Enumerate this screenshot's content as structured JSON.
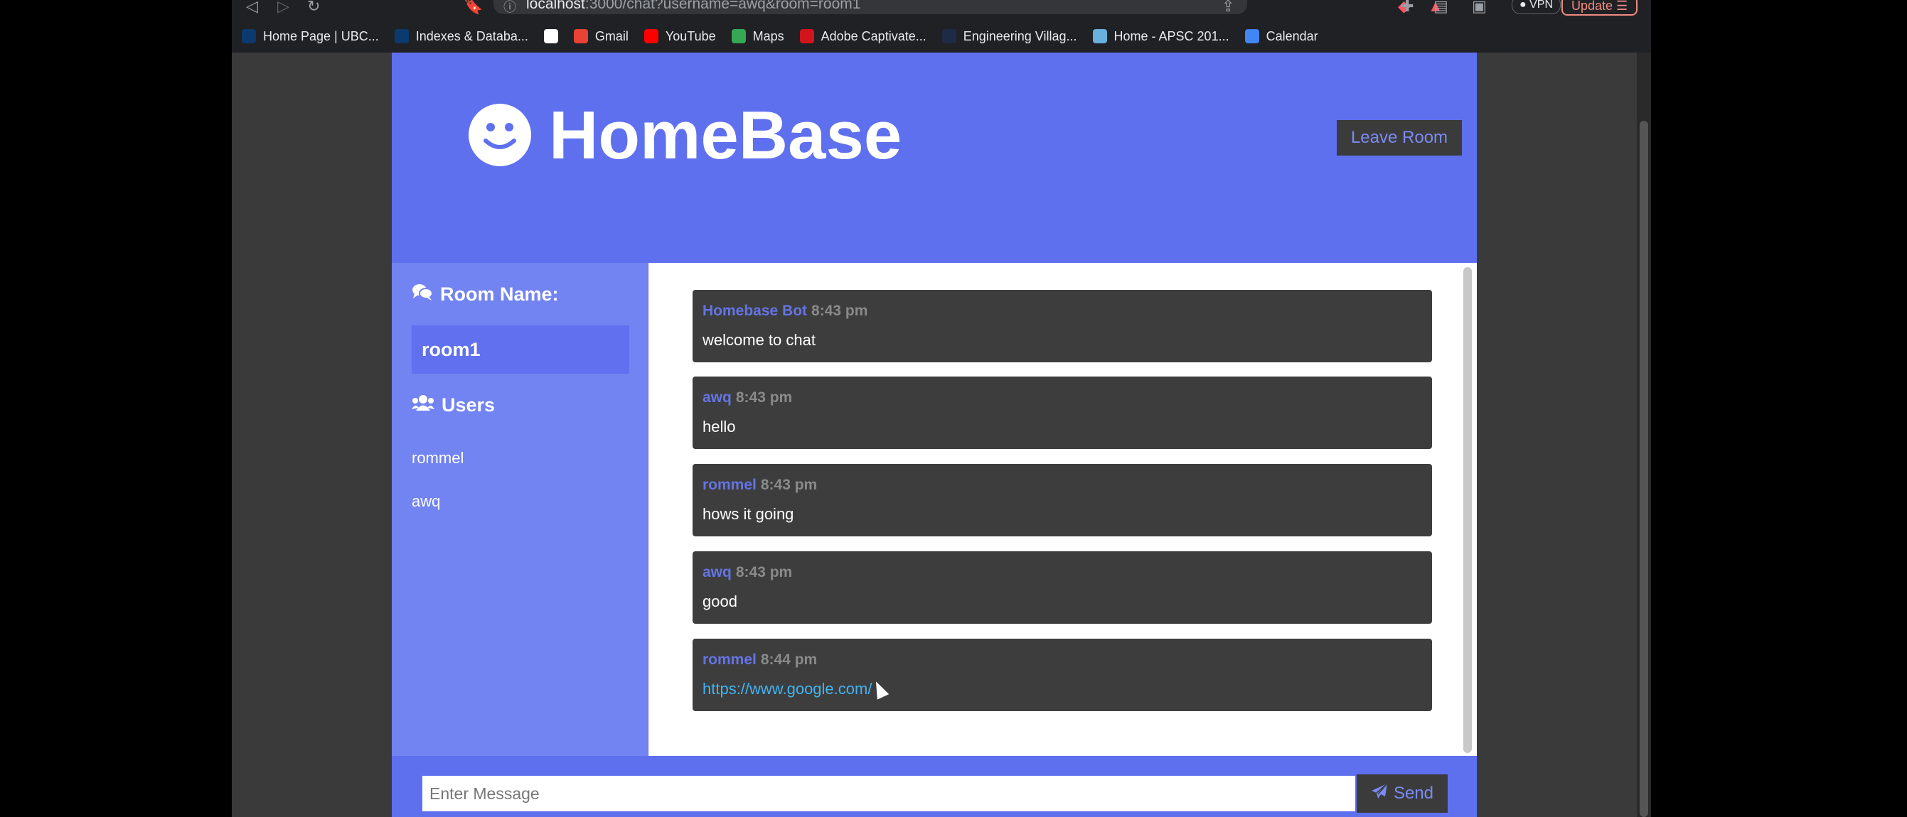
{
  "browser": {
    "url_host": "localhost",
    "url_rest": ":3000/chat?username=awq&room=room1",
    "vpn_label": "VPN",
    "update_label": "Update",
    "bookmarks": [
      {
        "label": "Home Page | UBC...",
        "icon": "ubc-icon",
        "color": "#0b3b6e"
      },
      {
        "label": "Indexes & Databa...",
        "icon": "ubc-icon",
        "color": "#0b3b6e"
      },
      {
        "label": "",
        "icon": "google-icon",
        "color": "#ffffff"
      },
      {
        "label": "Gmail",
        "icon": "gmail-icon",
        "color": "#ea4335"
      },
      {
        "label": "YouTube",
        "icon": "youtube-icon",
        "color": "#ff0000"
      },
      {
        "label": "Maps",
        "icon": "maps-icon",
        "color": "#34a853"
      },
      {
        "label": "Adobe Captivate...",
        "icon": "adobe-icon",
        "color": "#d4141c"
      },
      {
        "label": "Engineering Villag...",
        "icon": "elsevier-icon",
        "color": "#1f2b46"
      },
      {
        "label": "Home - APSC 201...",
        "icon": "cloud-icon",
        "color": "#6ab0de"
      },
      {
        "label": "Calendar",
        "icon": "calendar-icon",
        "color": "#4285f4"
      }
    ]
  },
  "header": {
    "title": "HomeBase",
    "leave_label": "Leave Room"
  },
  "sidebar": {
    "room_heading": "Room Name:",
    "room_name": "room1",
    "users_heading": "Users",
    "users": [
      "rommel",
      "awq"
    ]
  },
  "messages": [
    {
      "user": "Homebase Bot",
      "time": "8:43 pm",
      "text": "welcome to chat"
    },
    {
      "user": "awq",
      "time": "8:43 pm",
      "text": "hello"
    },
    {
      "user": "rommel",
      "time": "8:43 pm",
      "text": "hows it going"
    },
    {
      "user": "awq",
      "time": "8:43 pm",
      "text": "good"
    },
    {
      "user": "rommel",
      "time": "8:44 pm",
      "text": "https://www.google.com/"
    }
  ],
  "composer": {
    "placeholder": "Enter Message",
    "send_label": "Send"
  },
  "colors": {
    "brand": "#5f70ef",
    "sidebar": "#7283f2",
    "message_bg": "#3d3d3d",
    "username": "#6474e5",
    "link": "#42b4f2"
  }
}
